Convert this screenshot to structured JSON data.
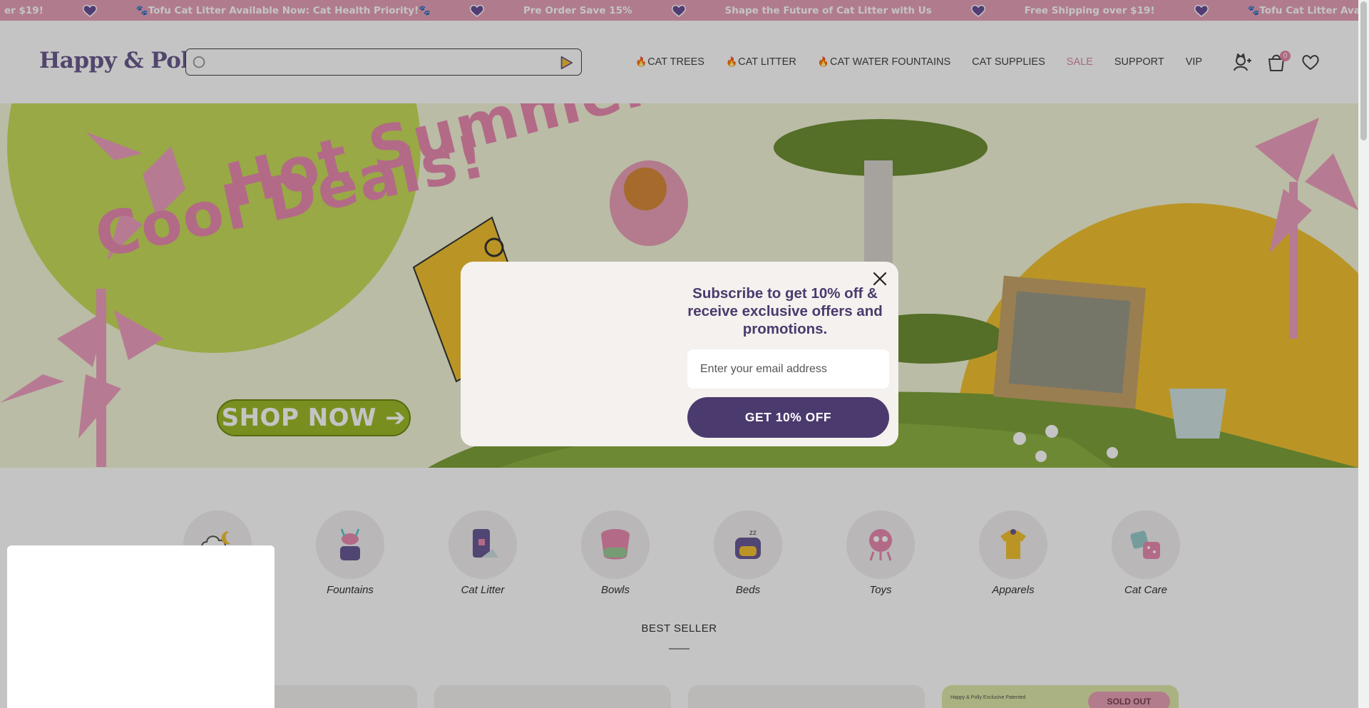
{
  "announcement": {
    "items": [
      "er $19!",
      "🐾Tofu Cat Litter Available Now: Cat Health Priority!🐾",
      "Pre Order Save 15%",
      "Shape the Future of Cat Litter with Us",
      "Free Shipping over $19!",
      "🐾Tofu Cat Litter Available Now: Cat Health Priority!🐾"
    ],
    "heart_icon": "heart-icon",
    "background": "#e6a2b8"
  },
  "header": {
    "logo": "Happy & Polly",
    "search": {
      "placeholder": ""
    },
    "nav": [
      {
        "label": "CAT TREES",
        "hot": true,
        "name": "nav-cat-trees"
      },
      {
        "label": "CAT LITTER",
        "hot": true,
        "name": "nav-cat-litter"
      },
      {
        "label": "CAT WATER FOUNTAINS",
        "hot": true,
        "name": "nav-cat-water-fountains"
      },
      {
        "label": "CAT SUPPLIES",
        "hot": false,
        "name": "nav-cat-supplies"
      },
      {
        "label": "SALE",
        "hot": false,
        "name": "nav-sale"
      },
      {
        "label": "SUPPORT",
        "hot": false,
        "name": "nav-support"
      },
      {
        "label": "VIP",
        "hot": false,
        "name": "nav-vip"
      }
    ],
    "cart_count": "0",
    "hot_icon": "🔥"
  },
  "hero": {
    "title_line1": "Hot Summer",
    "title_line2": "Cool Deals!",
    "cta": "SHOP NOW ➔"
  },
  "categories": [
    {
      "label": "",
      "icon": "cloud-moon-icon"
    },
    {
      "label": "Fountains",
      "icon": "fountain-icon"
    },
    {
      "label": "Cat Litter",
      "icon": "litter-bag-icon"
    },
    {
      "label": "Bowls",
      "icon": "bowl-icon"
    },
    {
      "label": "Beds",
      "icon": "bed-icon"
    },
    {
      "label": "Toys",
      "icon": "toy-icon"
    },
    {
      "label": "Apparels",
      "icon": "apparel-icon"
    },
    {
      "label": "Cat Care",
      "icon": "cat-care-icon"
    }
  ],
  "best_seller": {
    "title": "BEST SELLER",
    "sold_out": "SOLD OUT",
    "exclusive_tag": "Happy & Polly Exclusive Patented"
  },
  "modal": {
    "title": "Subscribe to get 10% off & receive exclusive offers and promotions.",
    "email_placeholder": "Enter your email address",
    "button": "GET 10% OFF"
  },
  "colors": {
    "brand_purple": "#4b3a6e",
    "pink": "#e98ab0",
    "lime": "#9cbb2a",
    "yellow": "#f2c232"
  }
}
